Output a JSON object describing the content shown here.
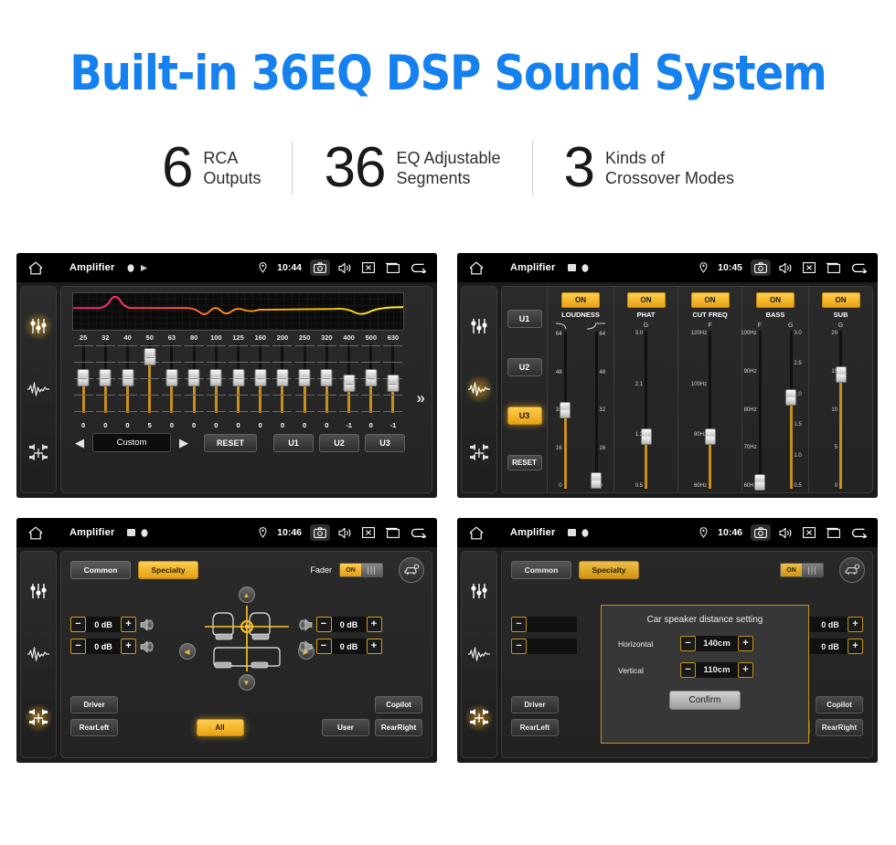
{
  "header": {
    "title": "Built-in 36EQ DSP Sound System",
    "stats": [
      {
        "number": "6",
        "line1": "RCA",
        "line2": "Outputs"
      },
      {
        "number": "36",
        "line1": "EQ Adjustable",
        "line2": "Segments"
      },
      {
        "number": "3",
        "line1": "Kinds of",
        "line2": "Crossover Modes"
      }
    ]
  },
  "colors": {
    "title_blue": "#1581ef",
    "accent_orange": "#e9a313",
    "screen_bg": "#1c1c1c"
  },
  "statusbar": {
    "app_title": "Amplifier",
    "icons": {
      "home": "home-icon",
      "location": "location-pin-icon",
      "camera": "camera-icon",
      "volume": "volume-icon",
      "close": "close-box-icon",
      "recents": "recents-icon",
      "back": "back-arrow-icon"
    },
    "times": {
      "screen1": "10:44",
      "screen2": "10:45",
      "screen3": "10:46",
      "screen4": "10:46"
    }
  },
  "sidebar": {
    "items": [
      {
        "name": "equalizer-icon"
      },
      {
        "name": "waveform-icon"
      },
      {
        "name": "speaker-balance-icon"
      }
    ]
  },
  "screen1": {
    "name": "Equalizer",
    "frequencies": [
      "25",
      "32",
      "40",
      "50",
      "63",
      "80",
      "100",
      "125",
      "160",
      "200",
      "250",
      "320",
      "400",
      "500",
      "630"
    ],
    "values": [
      "0",
      "0",
      "0",
      "5",
      "0",
      "0",
      "0",
      "0",
      "0",
      "0",
      "0",
      "0",
      "-1",
      "0",
      "-1"
    ],
    "slider_positions": [
      50,
      50,
      50,
      80,
      50,
      50,
      50,
      50,
      50,
      50,
      50,
      50,
      42,
      50,
      42
    ],
    "preset_label": "Custom",
    "prev_arrow": "◀",
    "next_arrow": "▶",
    "reset_label": "RESET",
    "user_buttons": [
      "U1",
      "U2",
      "U3"
    ],
    "more_chevron": "»",
    "curve": {
      "description": "EQ response curve, magenta to yellow gradient",
      "colors": [
        "#ff1f7a",
        "#ff6a1e",
        "#ffd400",
        "#ffee33"
      ]
    }
  },
  "screen2": {
    "name": "Sound Effects",
    "presets": [
      "U1",
      "U2",
      "U3"
    ],
    "active_preset": "U3",
    "reset_label": "RESET",
    "columns": [
      {
        "label": "LOUDNESS",
        "state": "ON",
        "sliders": [
          {
            "unit": "",
            "scale": [
              "64",
              "48",
              "32",
              "16",
              "0"
            ],
            "value": 32,
            "pos": 50
          },
          {
            "unit": "",
            "scale": [
              "64",
              "48",
              "32",
              "16",
              "0"
            ],
            "value": 0,
            "pos": 5
          }
        ]
      },
      {
        "label": "PHAT",
        "state": "ON",
        "sliders": [
          {
            "unit": "G",
            "scale": [
              "3.0",
              "2.1",
              "1.3",
              "0.5"
            ],
            "value": 1.3,
            "pos": 33
          }
        ]
      },
      {
        "label": "CUT FREQ",
        "state": "ON",
        "sliders": [
          {
            "unit": "F",
            "scale": [
              "120Hz",
              "100Hz",
              "80Hz",
              "60Hz"
            ],
            "value": "80Hz",
            "pos": 33
          }
        ]
      },
      {
        "label": "BASS",
        "state": "ON",
        "sliders": [
          {
            "unit": "F",
            "scale": [
              "100Hz",
              "90Hz",
              "80Hz",
              "70Hz",
              "60Hz"
            ],
            "value": "60Hz",
            "pos": 4
          },
          {
            "unit": "G",
            "scale": [
              "3.0",
              "2.5",
              "2.0",
              "1.5",
              "1.0",
              "0.5"
            ],
            "value": 2.0,
            "pos": 58
          }
        ]
      },
      {
        "label": "SUB",
        "state": "ON",
        "sliders": [
          {
            "unit": "G",
            "scale": [
              "20",
              "15",
              "10",
              "5",
              "0"
            ],
            "value": 15,
            "pos": 72
          }
        ]
      }
    ]
  },
  "screen3": {
    "name": "Balance / Fader",
    "tabs": [
      {
        "label": "Common",
        "active": false
      },
      {
        "label": "Specialty",
        "active": true
      }
    ],
    "fader_label": "Fader",
    "fader_state": "ON",
    "car_settings_icon": "car-settings-icon",
    "speakers": [
      {
        "position": "front-left",
        "value": "0 dB"
      },
      {
        "position": "rear-left",
        "value": "0 dB"
      },
      {
        "position": "front-right",
        "value": "0 dB"
      },
      {
        "position": "rear-right",
        "value": "0 dB"
      }
    ],
    "minus": "−",
    "plus": "+",
    "buttons": [
      {
        "label": "Driver",
        "active": false
      },
      {
        "label": "RearLeft",
        "active": false
      },
      {
        "label": "All",
        "active": true
      },
      {
        "label": "User",
        "active": false
      },
      {
        "label": "Copilot",
        "active": false
      },
      {
        "label": "RearRight",
        "active": false
      }
    ]
  },
  "screen4": {
    "name": "Car speaker distance dialog",
    "dialog": {
      "title": "Car speaker distance setting",
      "rows": [
        {
          "label": "Horizontal",
          "value": "140cm"
        },
        {
          "label": "Vertical",
          "value": "110cm"
        }
      ],
      "confirm_label": "Confirm",
      "minus": "−",
      "plus": "+"
    }
  }
}
